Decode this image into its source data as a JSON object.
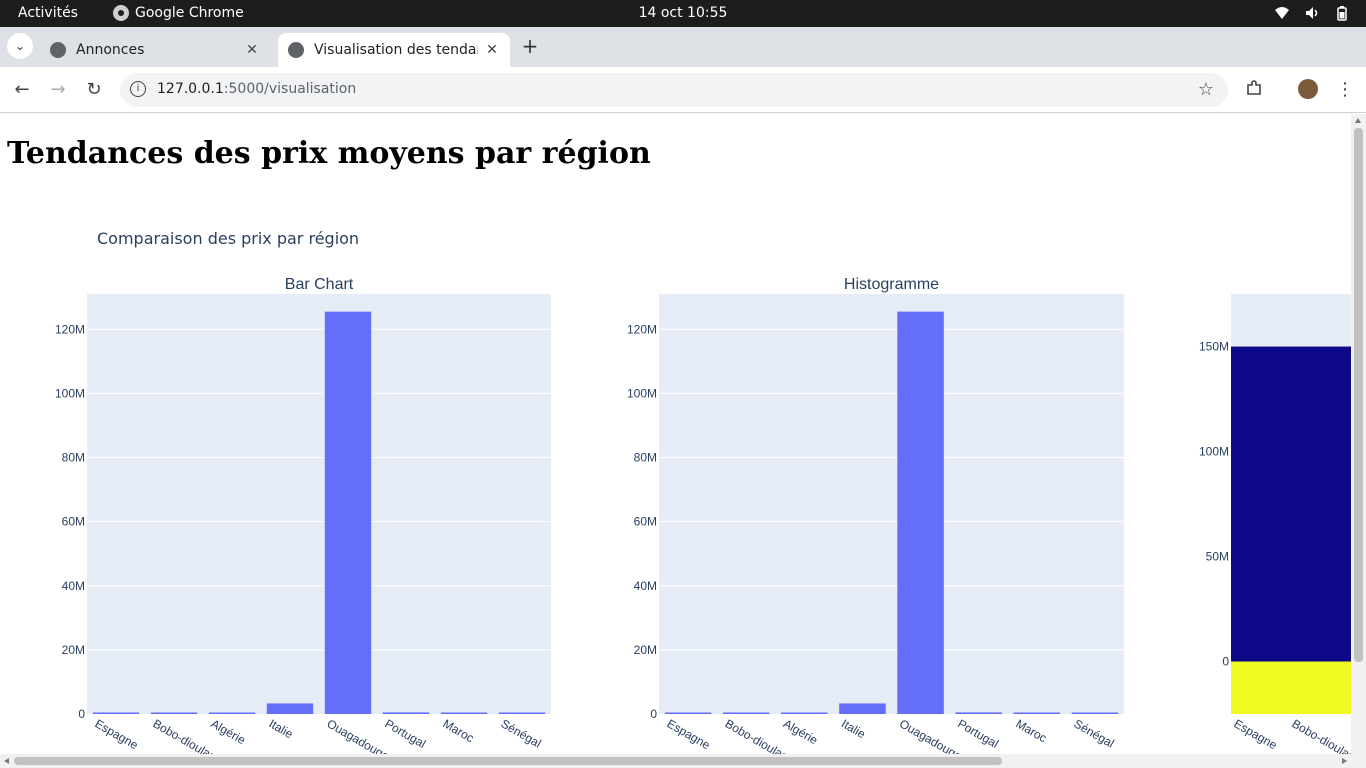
{
  "system_bar": {
    "activities": "Activités",
    "app_name": "Google Chrome",
    "clock": "14 oct  10:55",
    "tray_icons": [
      "wifi-icon",
      "volume-icon",
      "battery-icon"
    ]
  },
  "browser": {
    "tabs": [
      {
        "title": "Annonces",
        "active": false
      },
      {
        "title": "Visualisation des tendances",
        "active": true
      }
    ],
    "url_host": "127.0.0.1",
    "url_rest": ":5000/visualisation"
  },
  "page": {
    "heading": "Tendances des prix moyens par région",
    "figure_title": "Comparaison des prix par région"
  },
  "colors": {
    "plot_bg": "#e5ecf6",
    "bar": "#636efa",
    "axis_text": "#2a3f5f",
    "navy": "#0d0887",
    "yellow": "#f0f921"
  },
  "chart_data": [
    {
      "type": "bar",
      "title": "Bar Chart",
      "categories": [
        "Espagne",
        "Bobo-dioulasso",
        "Algérie",
        "Italie",
        "Ouagadougou",
        "Portugal",
        "Maroc",
        "Sénégal"
      ],
      "values": [
        150000,
        120000,
        130000,
        3300000,
        125500000,
        500000,
        110000,
        100000
      ],
      "ylim": [
        0,
        131000000
      ],
      "yticks": [
        0,
        20000000,
        40000000,
        60000000,
        80000000,
        100000000,
        120000000
      ],
      "ytick_labels": [
        "0",
        "20M",
        "40M",
        "60M",
        "80M",
        "100M",
        "120M"
      ]
    },
    {
      "type": "bar",
      "title": "Histogramme",
      "categories": [
        "Espagne",
        "Bobo-dioulasso",
        "Algérie",
        "Italie",
        "Ouagadougou",
        "Portugal",
        "Maroc",
        "Sénégal"
      ],
      "values": [
        150000,
        120000,
        130000,
        3300000,
        125500000,
        500000,
        110000,
        100000
      ],
      "ylim": [
        0,
        131000000
      ],
      "yticks": [
        0,
        20000000,
        40000000,
        60000000,
        80000000,
        100000000,
        120000000
      ],
      "ytick_labels": [
        "0",
        "20M",
        "40M",
        "60M",
        "80M",
        "100M",
        "120M"
      ]
    },
    {
      "type": "bar",
      "title": "",
      "categories": [
        "Espagne",
        "Bobo-dioulasso"
      ],
      "stack": [
        {
          "value": 25000000,
          "color": "#f0f921"
        },
        {
          "value": 150000000,
          "color": "#0d0887"
        }
      ],
      "ylim": [
        -25000000,
        175000000
      ],
      "yticks": [
        0,
        50000000,
        100000000,
        150000000
      ],
      "ytick_labels": [
        "0",
        "50M",
        "100M",
        "150M"
      ]
    }
  ]
}
